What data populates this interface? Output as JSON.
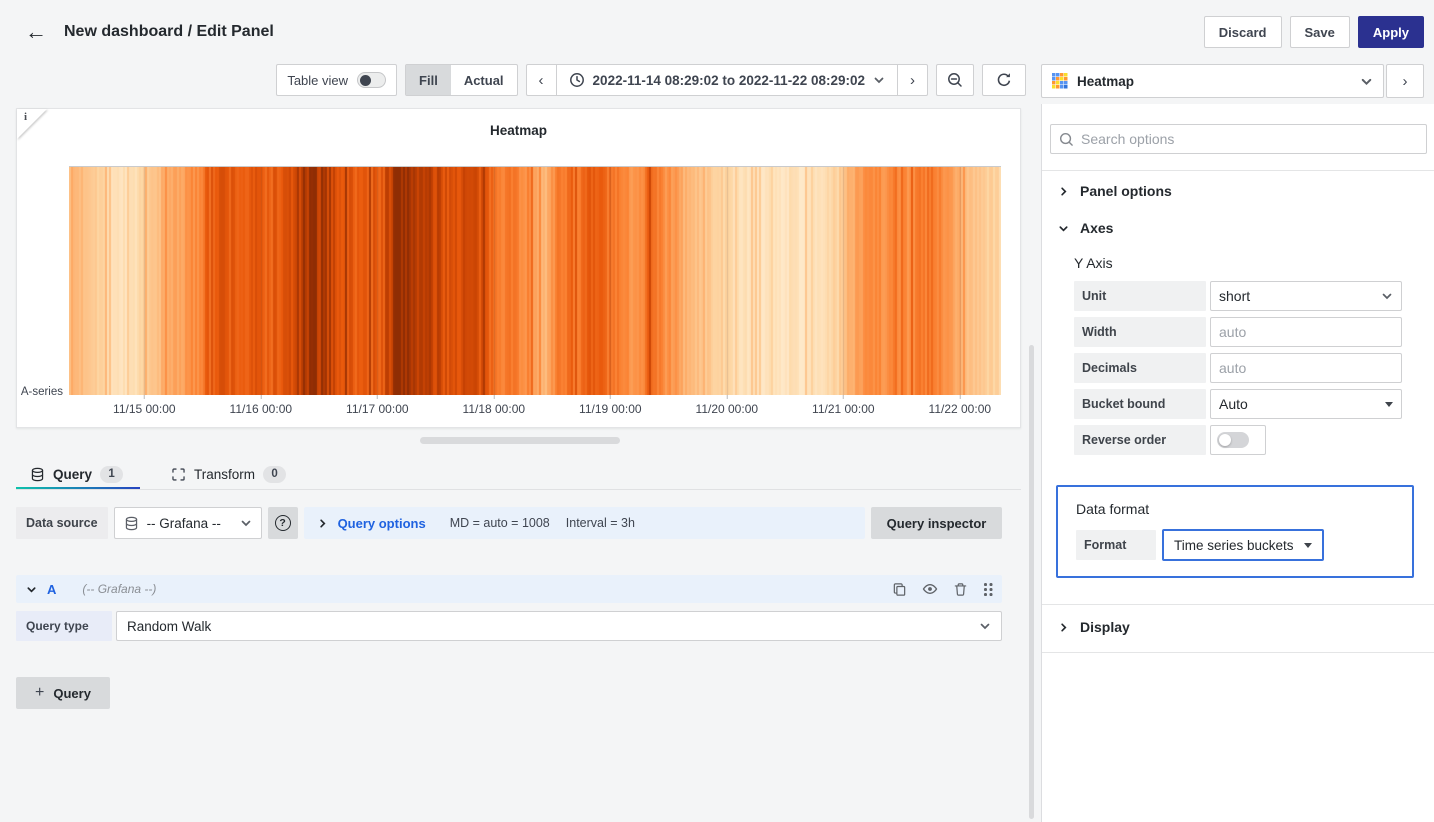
{
  "colors": {
    "page_bg": "#f4f5f6",
    "pane_bg": "#ffffff",
    "border": "#cfd0d2",
    "border_light": "#e4e5e6",
    "text_primary": "#24292e",
    "text_secondary": "#6e737a",
    "link_blue": "#1f62e0",
    "apply_bg": "#2b3190",
    "highlight_blue": "#3871dc",
    "row_blue_bg": "#e9f1fb",
    "label_gray_bg": "#f0f1f2",
    "handle_gray": "#d9dadc",
    "underline_start": "#0ec2ab",
    "underline_end": "#2743c0"
  },
  "header": {
    "back_icon": "←",
    "title": "New dashboard / Edit Panel",
    "discard": "Discard",
    "save": "Save",
    "apply": "Apply"
  },
  "toolbar": {
    "table_view": "Table view",
    "fill": "Fill",
    "actual": "Actual",
    "prev_icon": "‹",
    "time_range": "2022-11-14 08:29:02 to 2022-11-22 08:29:02",
    "next_icon": "›"
  },
  "viz_picker": {
    "name": "Heatmap",
    "expand_icon": "›"
  },
  "options_pane": {
    "search_placeholder": "Search options",
    "panel_options": "Panel options",
    "axes": "Axes",
    "y_axis": "Y Axis",
    "unit_label": "Unit",
    "unit_value": "short",
    "width_label": "Width",
    "width_placeholder": "auto",
    "decimals_label": "Decimals",
    "decimals_placeholder": "auto",
    "bucket_bound_label": "Bucket bound",
    "bucket_bound_value": "Auto",
    "reverse_order_label": "Reverse order",
    "data_format_title": "Data format",
    "format_label": "Format",
    "format_value": "Time series buckets",
    "display": "Display"
  },
  "panel": {
    "title": "Heatmap",
    "info_icon": "i"
  },
  "tabs": {
    "query_label": "Query",
    "query_count": "1",
    "transform_label": "Transform",
    "transform_count": "0"
  },
  "query_editor": {
    "datasource_label": "Data source",
    "datasource_value": "-- Grafana --",
    "help_icon": "?",
    "query_options_label": "Query options",
    "max_data_points": "MD = auto = 1008",
    "interval": "Interval = 3h",
    "inspector_label": "Query inspector",
    "row_ref": "A",
    "row_datasource": "(-- Grafana --)",
    "query_type_label": "Query type",
    "query_type_value": "Random Walk",
    "add_query_label": "Query",
    "plus_icon": "+"
  },
  "chart_data": {
    "type": "heatmap",
    "title": "Heatmap",
    "y_categories": [
      "A-series"
    ],
    "x_range": [
      "2022-11-14 08:29:02",
      "2022-11-22 08:29:02"
    ],
    "x_ticks": [
      {
        "label": "11/15 00:00",
        "pct": 8.08
      },
      {
        "label": "11/16 00:00",
        "pct": 20.58
      },
      {
        "label": "11/17 00:00",
        "pct": 33.08
      },
      {
        "label": "11/18 00:00",
        "pct": 45.58
      },
      {
        "label": "11/19 00:00",
        "pct": 58.08
      },
      {
        "label": "11/20 00:00",
        "pct": 70.58
      },
      {
        "label": "11/21 00:00",
        "pct": 83.08
      },
      {
        "label": "11/22 00:00",
        "pct": 95.58
      }
    ],
    "color_scheme": "Oranges",
    "color_scale": {
      "positions": [
        0,
        0.18,
        0.38,
        0.55,
        0.72,
        0.88,
        1
      ],
      "colors": [
        "#FFF3E0",
        "#FDD9A8",
        "#FDAE6B",
        "#FB8334",
        "#E9590C",
        "#C44103",
        "#8F2D04"
      ]
    },
    "intensity_note": "estimated normalized bucket density (random-walk data) sampled uniformly across the 8-day range",
    "intensity": [
      0.35,
      0.32,
      0.28,
      0.18,
      0.13,
      0.12,
      0.16,
      0.25,
      0.32,
      0.42,
      0.45,
      0.52,
      0.68,
      0.75,
      0.72,
      0.7,
      0.72,
      0.7,
      0.72,
      0.78,
      0.9,
      0.93,
      0.9,
      0.8,
      0.74,
      0.7,
      0.72,
      0.74,
      0.95,
      0.98,
      0.92,
      0.84,
      0.8,
      0.78,
      0.82,
      0.78,
      0.68,
      0.62,
      0.58,
      0.55,
      0.45,
      0.35,
      0.55,
      0.66,
      0.62,
      0.7,
      0.66,
      0.55,
      0.5,
      0.52,
      0.7,
      0.52,
      0.45,
      0.35,
      0.28,
      0.25,
      0.22,
      0.15,
      0.12,
      0.1,
      0.12,
      0.1,
      0.13,
      0.1,
      0.12,
      0.15,
      0.2,
      0.35,
      0.48,
      0.55,
      0.5,
      0.58,
      0.52,
      0.55,
      0.6,
      0.5,
      0.42,
      0.32,
      0.28,
      0.22,
      0.18
    ]
  }
}
